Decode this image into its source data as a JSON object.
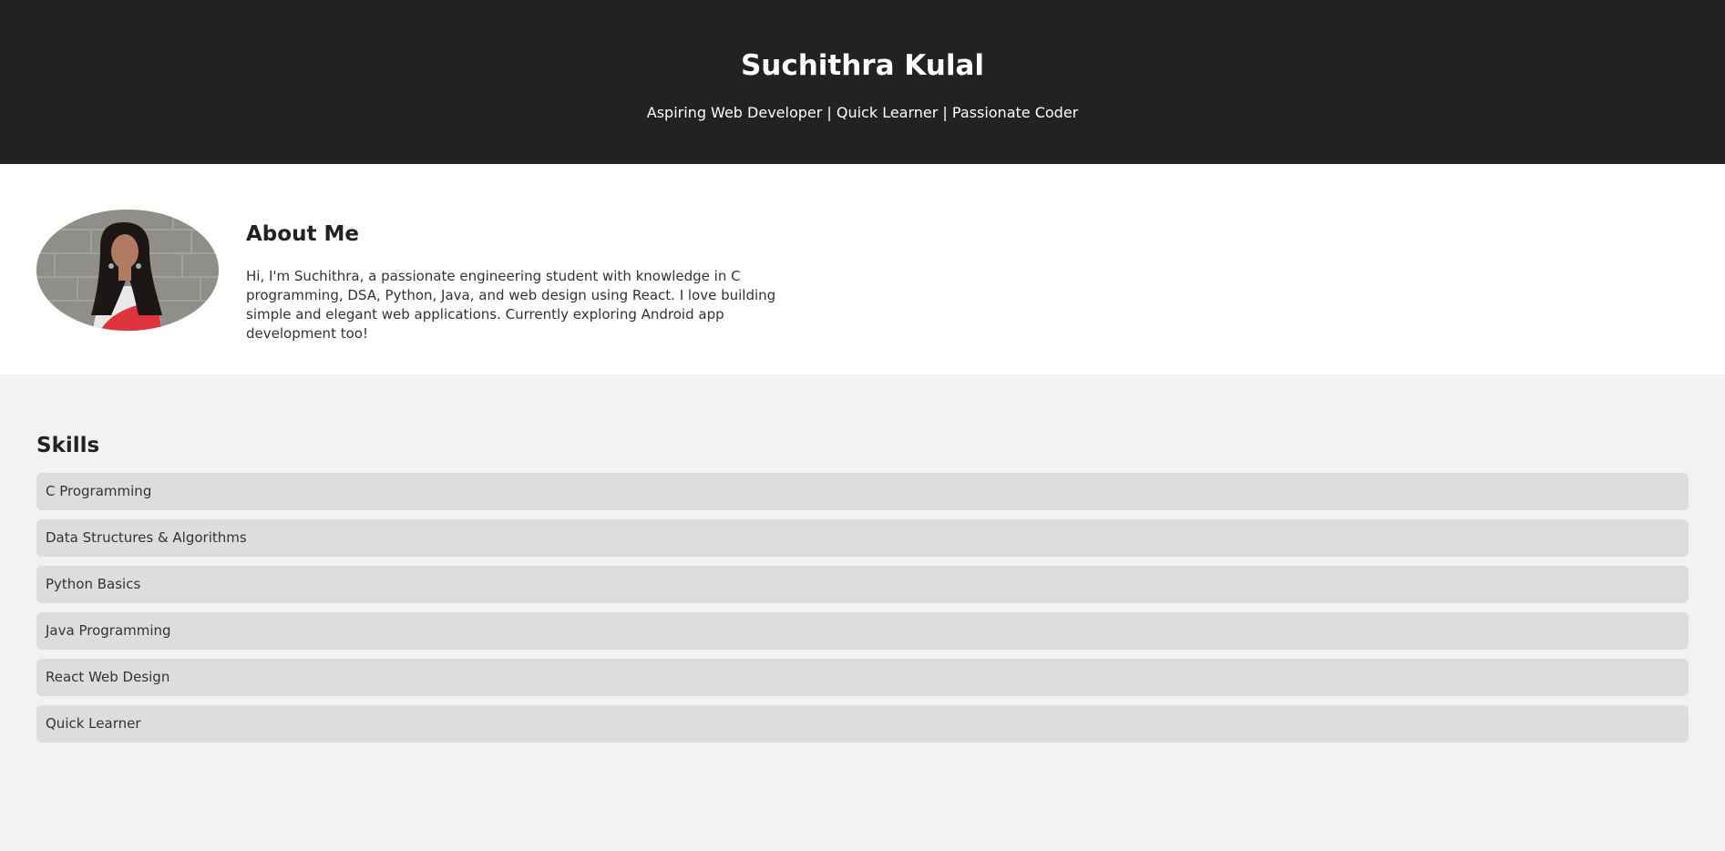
{
  "header": {
    "name": "Suchithra Kulal",
    "tagline": "Aspiring Web Developer | Quick Learner | Passionate Coder"
  },
  "about": {
    "title": "About Me",
    "bio": "Hi, I'm Suchithra, a passionate engineering student with knowledge in C programming, DSA, Python, Java, and web design using React. I love building simple and elegant web applications. Currently exploring Android app development too!"
  },
  "skills": {
    "title": "Skills",
    "items": [
      "C Programming",
      "Data Structures & Algorithms",
      "Python Basics",
      "Java Programming",
      "React Web Design",
      "Quick Learner"
    ]
  },
  "colors": {
    "header_bg": "#222222",
    "about_bg": "#ffffff",
    "skills_bg": "#f2f2f2",
    "skill_item_bg": "#dddddd"
  }
}
